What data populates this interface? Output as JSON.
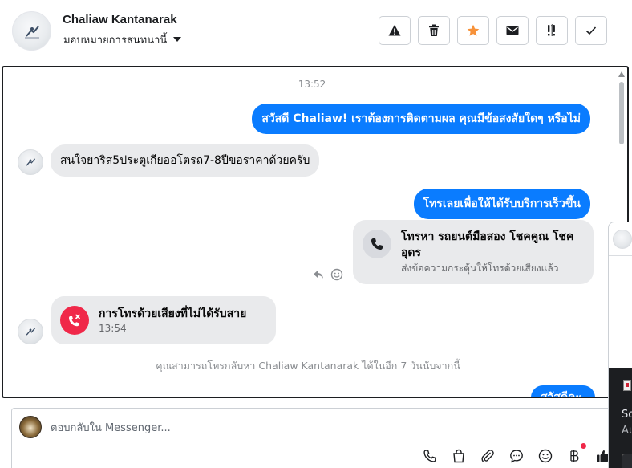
{
  "header": {
    "contact_name": "Chaliaw Kantanarak",
    "assign_label": "มอบหมายการสนทนานี้",
    "tools": [
      {
        "icon": "warning-icon"
      },
      {
        "icon": "trash-icon"
      },
      {
        "icon": "star-icon",
        "color": "#f7923a"
      },
      {
        "icon": "envelope-icon"
      },
      {
        "icon": "priority-icon"
      },
      {
        "icon": "checkmark-icon"
      }
    ]
  },
  "chat": {
    "timestamp": "13:52",
    "messages": [
      {
        "direction": "out",
        "text": "สวัสดี Chaliaw! เราต้องการติดตามผล คุณมีข้อสงสัยใดๆ หรือไม่"
      },
      {
        "direction": "in",
        "text": "สนใจยาริส5ประตูเกียออโตรถ7-8ปีขอราคาด้วยครับ"
      },
      {
        "direction": "out",
        "text": "โทรเลยเพื่อให้ได้รับบริการเร็วขึ้น"
      }
    ],
    "call_card": {
      "title": "โทรหา รถยนต์มือสอง โชคคูณ โชค อุดร",
      "subtitle": "ส่งข้อความกระตุ้นให้โทรด้วยเสียงแล้ว"
    },
    "missed_call": {
      "title": "การโทรด้วยเสียงที่ไม่ได้รับสาย",
      "time": "13:54"
    },
    "notice": "คุณสามารถโทรกลับหา Chaliaw Kantanarak ได้ในอีก 7 วันนับจากนี้",
    "partial_bubble": "สวัสดีคะ"
  },
  "composer": {
    "placeholder": "ตอบกลับใน Messenger..."
  },
  "side_popup": {
    "text1": "So",
    "text2": "Au"
  },
  "colors": {
    "accent": "#0a7cff",
    "missed": "#f02849",
    "bubble_in": "#e9eaec"
  }
}
